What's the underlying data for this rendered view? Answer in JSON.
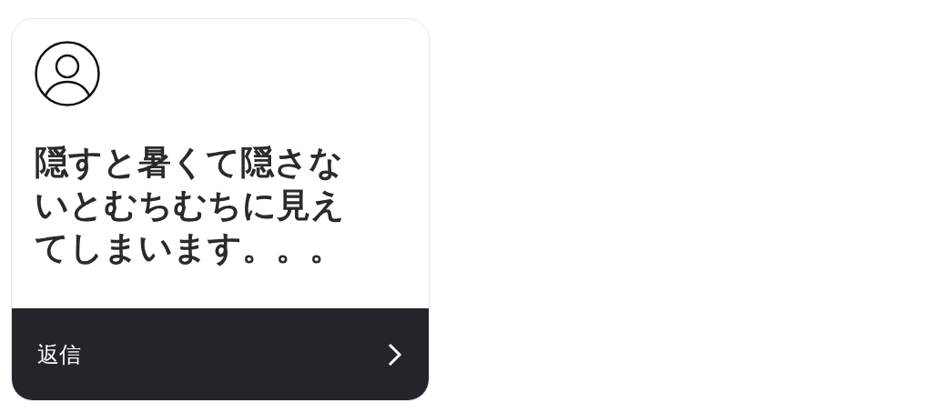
{
  "comment_card": {
    "message": "隠すと暑くて隠さないとむちむちに見えてしまいます。。。",
    "reply_bar": {
      "label": "返信"
    }
  }
}
